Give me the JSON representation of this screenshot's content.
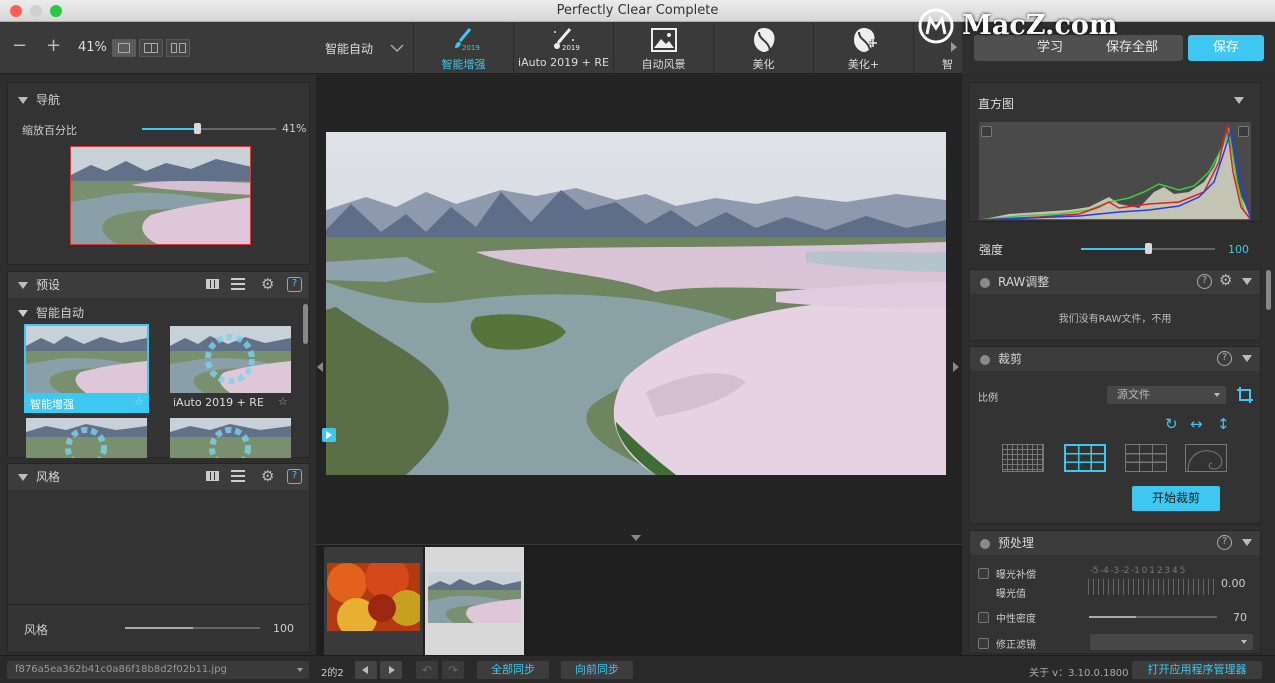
{
  "window": {
    "title": "Perfectly Clear Complete",
    "watermark": "MacZ.com"
  },
  "toolbar": {
    "zoom": "41%",
    "preset_dropdown": "智能自动",
    "tabs": [
      {
        "label": "智能增强",
        "active": true,
        "badge": "2019"
      },
      {
        "label": "iAuto 2019 + RE",
        "active": false,
        "badge": "2019"
      },
      {
        "label": "自动风景",
        "active": false
      },
      {
        "label": "美化",
        "active": false
      },
      {
        "label": "美化+",
        "active": false
      },
      {
        "label": "智",
        "active": false
      }
    ],
    "learn_label": "学习",
    "save_all_label": "保存全部",
    "save_label": "保存"
  },
  "nav": {
    "title": "导航",
    "zoom_label": "缩放百分比",
    "zoom_value": "41%",
    "zoom_fraction": 0.41
  },
  "presets": {
    "title": "预设",
    "group": "智能自动",
    "items": [
      {
        "label": "智能增强",
        "selected": true
      },
      {
        "label": "iAuto 2019 + RE",
        "selected": false
      }
    ]
  },
  "style": {
    "title": "风格",
    "footer_label": "风格",
    "footer_value": "100",
    "footer_fraction": 1.0
  },
  "filmstrip": {
    "count": 2
  },
  "histogram": {
    "title": "直方图"
  },
  "strength": {
    "label": "强度",
    "value": "100",
    "fraction": 0.5
  },
  "raw": {
    "title": "RAW调整",
    "message": "我们没有RAW文件，不用"
  },
  "crop": {
    "title": "裁剪",
    "ratio_label": "比例",
    "ratio_value": "源文件",
    "start_label": "开始裁剪"
  },
  "preprocess": {
    "title": "预处理",
    "exposure_label": "曝光补偿",
    "exposure_value_label": "曝光值",
    "exposure_scale": "-5 -4 -3 -2 -1 0 1 2 3 4 5",
    "exposure_value": "0.00",
    "nd_label": "中性密度",
    "nd_value": "70",
    "nd_fraction": 0.37,
    "lens_label": "修正滤镜"
  },
  "statusbar": {
    "filename": "f876a5ea362b41c0a86f18b8d2f02b11.jpg",
    "page": "2的2",
    "sync_all": "全部同步",
    "sync_forward": "向前同步",
    "version": "关于 v：3.10.0.1800",
    "open_manager": "打开应用程序管理器"
  },
  "colors": {
    "accent": "#3ec7f0",
    "bg": "#2b2b2b",
    "panel": "#333333"
  }
}
